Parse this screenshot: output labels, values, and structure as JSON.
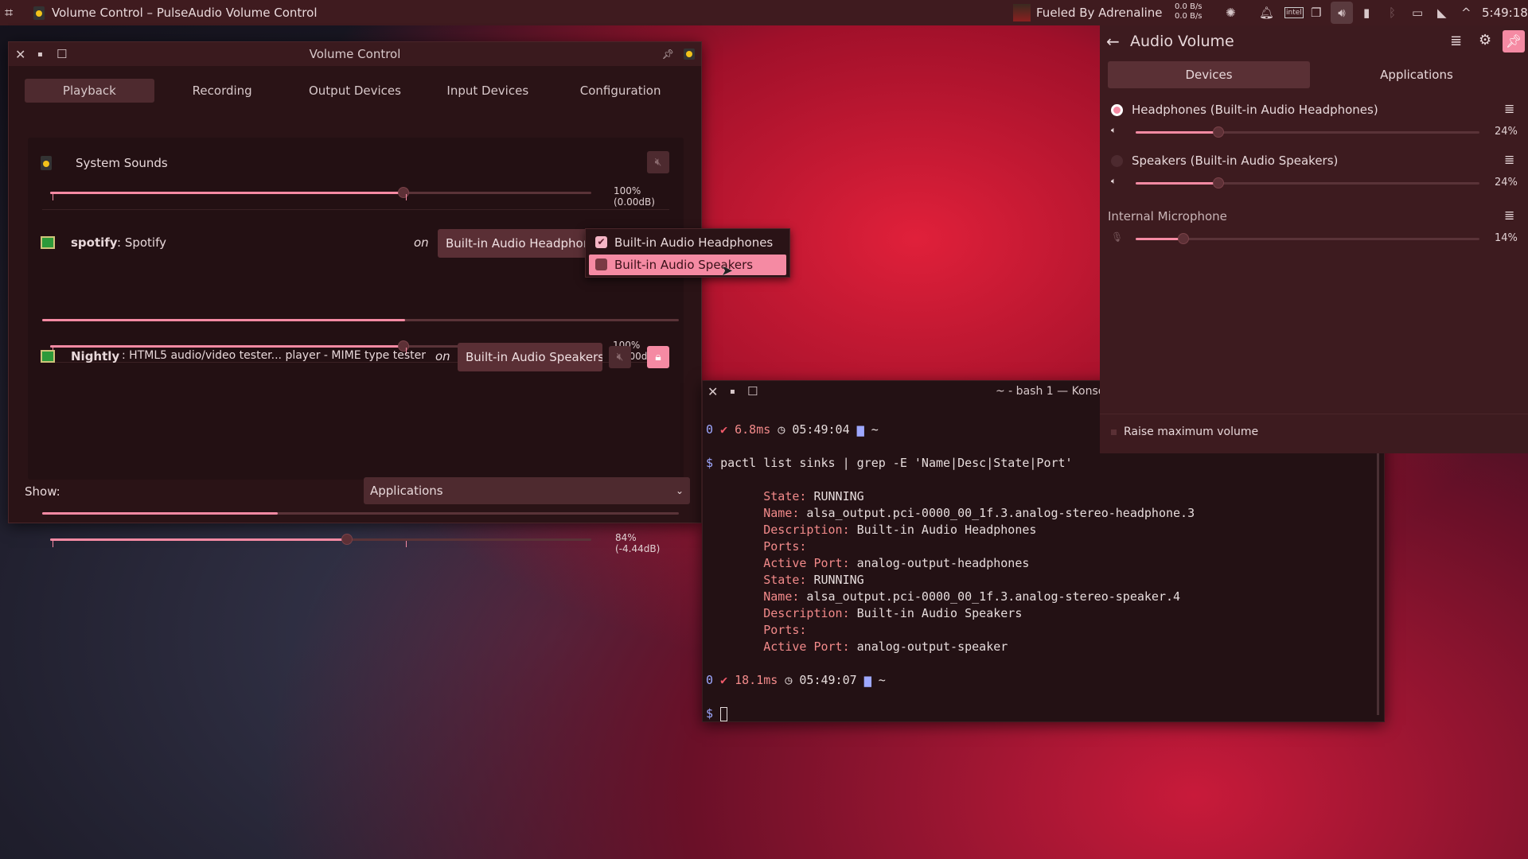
{
  "topbar": {
    "window_title": "Volume Control – PulseAudio Volume Control",
    "media": "Fueled By Adrenaline",
    "net_up": "0.0 B/s",
    "net_down": "0.0 B/s",
    "time": "5:49:18",
    "icons": [
      "launcher-icon",
      "brightness-icon",
      "bell-icon",
      "intel-gpu-icon",
      "clipboard-icon",
      "volume-icon",
      "battery-icon",
      "bluetooth-icon",
      "display-icon",
      "wifi-icon",
      "expand-arrow-icon"
    ]
  },
  "pavucontrol": {
    "title": "Volume Control",
    "tabs": [
      {
        "label": "Playback",
        "active": true
      },
      {
        "label": "Recording"
      },
      {
        "label": "Output Devices"
      },
      {
        "label": "Input Devices"
      },
      {
        "label": "Configuration"
      }
    ],
    "streams": [
      {
        "name": "System Sounds",
        "app": "",
        "volume_pct": 100,
        "volume_label": "100% (0.00dB)"
      },
      {
        "name": "spotify",
        "app": ": Spotify",
        "on": "on",
        "device": "Built-in Audio Headphones",
        "peak_pct": 57,
        "volume_pct": 100,
        "volume_label": "100% (-0.00dB)"
      },
      {
        "name": "Nightly",
        "app": ": HTML5 audio/video tester... player - MIME type tester",
        "on": "on",
        "device": "Built-in Audio Speakers",
        "peak_pct": 37,
        "volume_pct": 84,
        "volume_label": "84% (-4.44dB)"
      }
    ],
    "show_label": "Show:",
    "show_value": "Applications",
    "dropdown": {
      "items": [
        {
          "label": "Built-in Audio Headphones",
          "checked": true
        },
        {
          "label": "Built-in Audio Speakers",
          "checked": false,
          "highlighted": true
        }
      ]
    }
  },
  "konsole": {
    "title": "~ - bash 1 — Konsole",
    "prompt1": {
      "status": "0",
      "duration": "6.8ms",
      "time": "05:49:04",
      "dir": "~"
    },
    "command": "pactl list sinks | grep -E 'Name|Desc|State|Port'",
    "output": [
      [
        "State:",
        " RUNNING"
      ],
      [
        "Name:",
        " alsa_output.pci-0000_00_1f.3.analog-stereo-headphone.3"
      ],
      [
        "Description:",
        " Built-in Audio Headphones"
      ],
      [
        "Ports:",
        ""
      ],
      [
        "Active Port:",
        " analog-output-headphones"
      ],
      [
        "State:",
        " RUNNING"
      ],
      [
        "Name:",
        " alsa_output.pci-0000_00_1f.3.analog-stereo-speaker.4"
      ],
      [
        "Description:",
        " Built-in Audio Speakers"
      ],
      [
        "Ports:",
        ""
      ],
      [
        "Active Port:",
        " analog-output-speaker"
      ]
    ],
    "prompt2": {
      "status": "0",
      "duration": "18.1ms",
      "time": "05:49:07",
      "dir": "~"
    },
    "ps": "$"
  },
  "audio_volume": {
    "title": "Audio Volume",
    "tabs": [
      "Devices",
      "Applications"
    ],
    "devices": [
      {
        "name": "Headphones (Built-in Audio Headphones)",
        "default": true,
        "volume_pct": 24,
        "label": "24%"
      },
      {
        "name": "Speakers (Built-in Audio Speakers)",
        "default": false,
        "volume_pct": 24,
        "label": "24%"
      }
    ],
    "input": {
      "name": "Internal Microphone",
      "volume_pct": 14,
      "label": "14%"
    },
    "raise_max": "Raise maximum volume"
  },
  "colors": {
    "accent": "#f58aa3",
    "panel": "#2a1316",
    "topbar": "#3f1b1f"
  }
}
